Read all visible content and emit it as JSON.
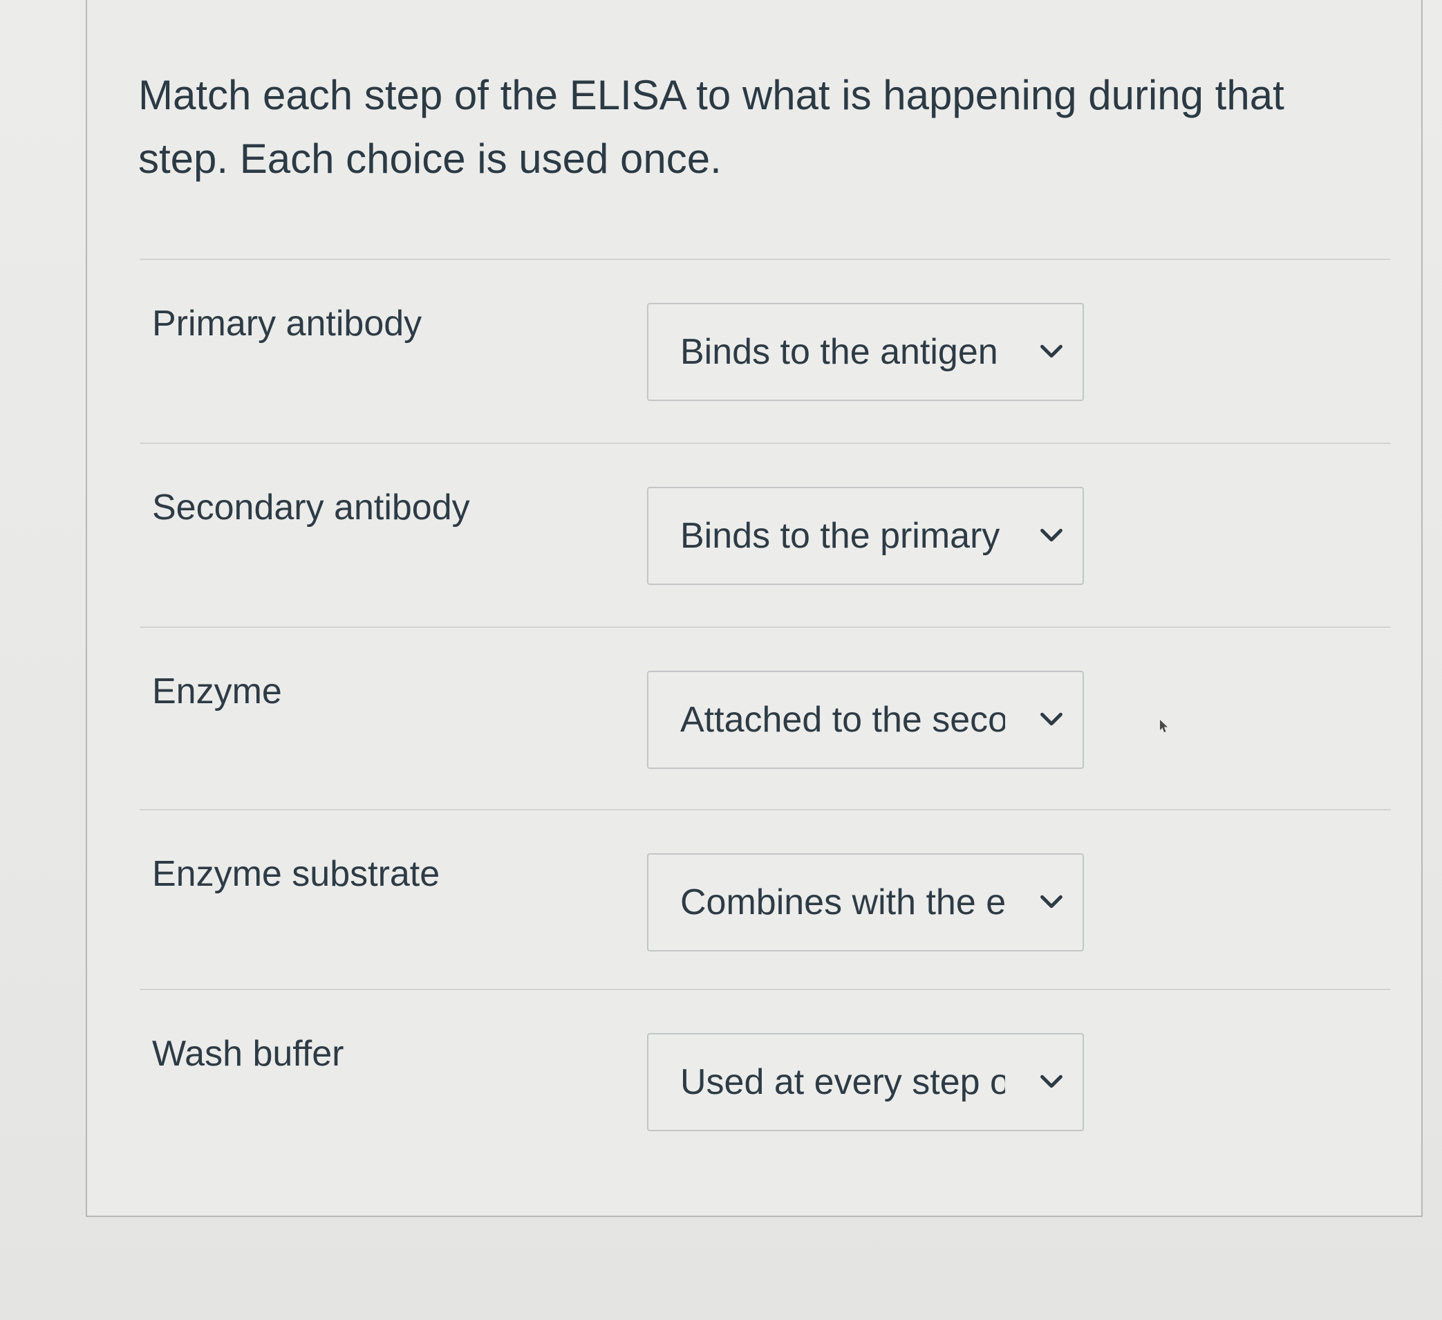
{
  "question": {
    "prompt": "Match each step of the ELISA to what is happening during that step. Each choice is used once."
  },
  "rows": [
    {
      "label": "Primary antibody",
      "selected": "Binds to the antigen"
    },
    {
      "label": "Secondary antibody",
      "selected": "Binds to the primary"
    },
    {
      "label": "Enzyme",
      "selected": "Attached to the seco"
    },
    {
      "label": "Enzyme substrate",
      "selected": "Combines with the e"
    },
    {
      "label": "Wash buffer",
      "selected": "Used at every step o"
    }
  ],
  "icons": {
    "dropdown": "chevron-down-icon",
    "pointer": "cursor-icon"
  }
}
